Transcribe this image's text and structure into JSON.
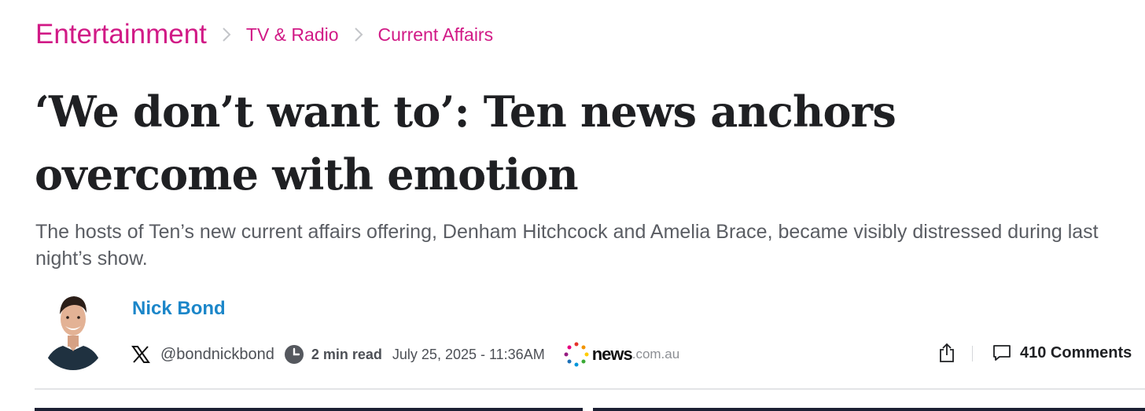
{
  "breadcrumb": {
    "section": "Entertainment",
    "subsection": "TV & Radio",
    "topic": "Current Affairs",
    "separator_icon": "chevron-right-icon"
  },
  "article": {
    "headline": "‘We don’t want to’: Ten news anchors overcome with emotion",
    "standfirst": "The hosts of Ten’s new current affairs offering, Denham Hitchcock and Amelia Brace, became visibly distressed during last night’s show."
  },
  "author": {
    "name": "Nick Bond",
    "social_icon": "x-logo-icon",
    "handle": "@bondnickbond"
  },
  "meta": {
    "read_time_icon": "clock-icon",
    "read_time": "2 min read",
    "published": "July 25, 2025 - 11:36AM",
    "publisher": {
      "name": "news",
      "domain": ".com.au"
    }
  },
  "actions": {
    "share_icon": "share-icon",
    "comments_icon": "comment-bubble-icon",
    "comments_label": "410 Comments"
  },
  "colors": {
    "accent": "#d11a86",
    "author_link": "#1b86c9",
    "headline": "#1f2023",
    "standfirst": "#5a5d63"
  }
}
